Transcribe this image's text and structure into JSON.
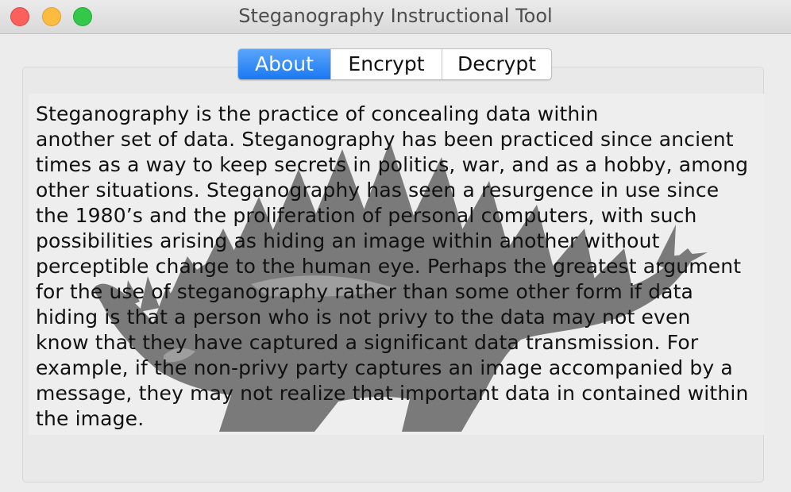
{
  "window": {
    "title": "Steganography Instructional Tool"
  },
  "tabs": [
    {
      "label": "About",
      "selected": true
    },
    {
      "label": "Encrypt",
      "selected": false
    },
    {
      "label": "Decrypt",
      "selected": false
    }
  ],
  "about": {
    "text": "                 Steganography is the practice of concealing data within\nanother set of data. Steganography has been practiced since ancient\ntimes as a way to keep secrets in politics, war, and as a hobby, among\nother situations. Steganography has seen a resurgence in use since\nthe 1980’s and the proliferation of personal computers, with such\npossibilities arising as hiding an image within another without\nperceptible change to the human eye. Perhaps the greatest argument\nfor the use of steganography rather than some other form if data\nhiding is that a person who is not privy to the data may not even\nknow that they have captured a significant data transmission. For\nexample, if the non-privy party captures an image accompanied by a\nmessage, they may not realize that important data in contained within\nthe image."
  },
  "colors": {
    "selected_tab": "#1a79f3",
    "close": "#fc605c",
    "minimize": "#fdbc40",
    "maximize": "#34c84a"
  }
}
